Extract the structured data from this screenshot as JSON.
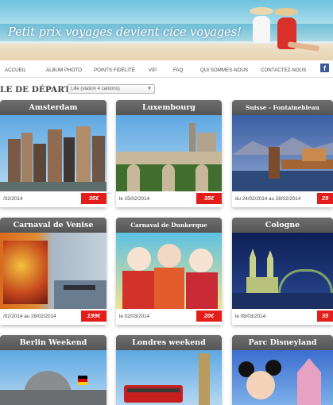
{
  "banner": {
    "title": "Petit prix voyages devient cice voyages!"
  },
  "nav": {
    "items": [
      "ACCUEIL",
      "ALBUM PHOTO",
      "POINTS FIDÉLITÉ",
      "VIP",
      "FAQ",
      "QUI SOMMES-NOUS",
      "CONTACTEZ-NOUS"
    ],
    "facebook_icon": "facebook-icon"
  },
  "filter": {
    "label": "LE DE DÉPART :",
    "selected": "Lille (station 4 cantons)"
  },
  "cards": [
    {
      "title": "Amsterdam",
      "date": "/02/2014",
      "price": "35€"
    },
    {
      "title": "Luxembourg",
      "date": "le 15/02/2014",
      "price": "35€"
    },
    {
      "title": "Suisse - Fontainebleau",
      "date": "du 24/02/2014 au 28/02/2014",
      "price": "29"
    },
    {
      "title": "Carnaval de Venise",
      "date": "/02/2014 au 28/02/2014",
      "price": "199€"
    },
    {
      "title": "Carnaval de Dunkerque",
      "date": "le 02/03/2014",
      "price": "20€"
    },
    {
      "title": "Cologne",
      "date": "le 08/03/2014",
      "price": "35"
    },
    {
      "title": "Berlin Weekend",
      "date": "",
      "price": ""
    },
    {
      "title": "Londres weekend",
      "date": "",
      "price": ""
    },
    {
      "title": "Parc Disneyland",
      "date": "",
      "price": ""
    }
  ],
  "colors": {
    "price_bg": "#e31d1a",
    "card_header": "#5f5f5f",
    "facebook": "#3b5998"
  }
}
